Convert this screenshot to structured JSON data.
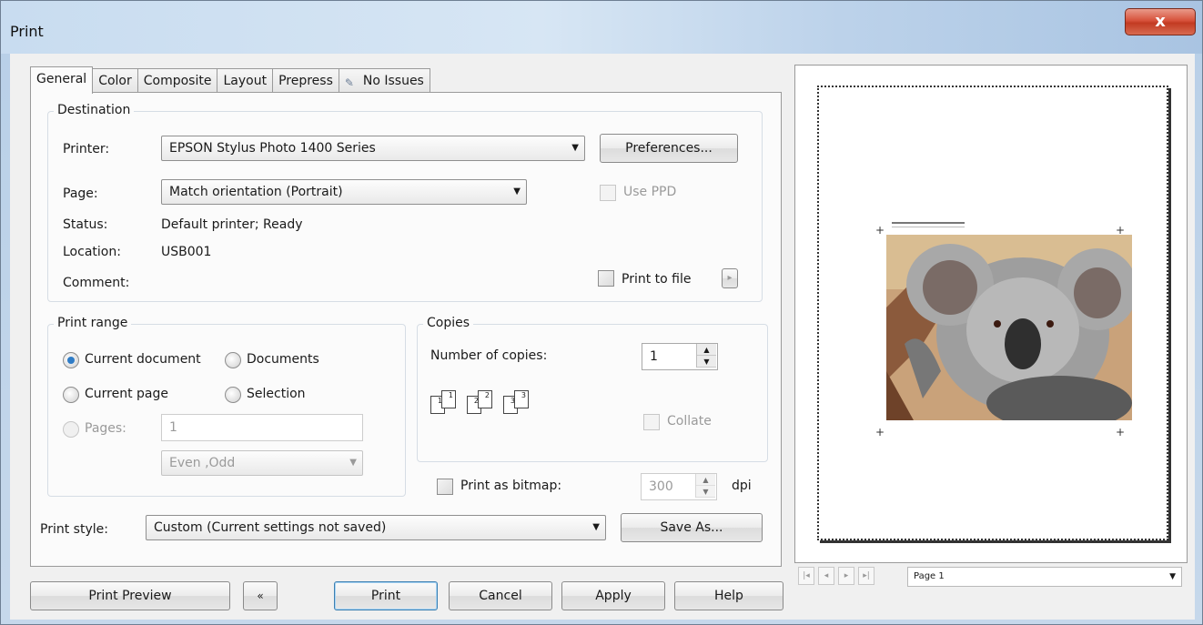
{
  "window": {
    "title": "Print",
    "close_glyph": "x"
  },
  "tabs": [
    {
      "label": "General"
    },
    {
      "label": "Color"
    },
    {
      "label": "Composite"
    },
    {
      "label": "Layout"
    },
    {
      "label": "Prepress"
    },
    {
      "label": "No Issues",
      "icon": "no-issues-icon"
    }
  ],
  "destination": {
    "title": "Destination",
    "printer_label": "Printer:",
    "printer_value": "EPSON Stylus Photo 1400 Series",
    "preferences_label": "Preferences...",
    "page_label": "Page:",
    "page_value": "Match orientation (Portrait)",
    "use_ppd_label": "Use PPD",
    "status_label": "Status:",
    "status_value": "Default printer; Ready",
    "location_label": "Location:",
    "location_value": "USB001",
    "comment_label": "Comment:",
    "print_to_file_label": "Print to file",
    "print_to_file_menu": "▸"
  },
  "print_range": {
    "title": "Print range",
    "current_document": "Current document",
    "documents": "Documents",
    "current_page": "Current page",
    "selection": "Selection",
    "pages_label": "Pages:",
    "pages_value": "1",
    "even_odd": "Even ,Odd"
  },
  "copies": {
    "title": "Copies",
    "number_label": "Number of copies:",
    "number_value": "1",
    "collate_label": "Collate",
    "collate_icon_pages": [
      "1",
      "1",
      "2",
      "2",
      "3",
      "3"
    ]
  },
  "bitmap": {
    "label": "Print as bitmap:",
    "dpi_value": "300",
    "dpi_unit": "dpi"
  },
  "print_style": {
    "label": "Print style:",
    "value": "Custom (Current settings not saved)",
    "save_as": "Save As..."
  },
  "buttons": {
    "print_preview": "Print Preview",
    "collapse": "«",
    "print": "Print",
    "cancel": "Cancel",
    "apply": "Apply",
    "help": "Help"
  },
  "preview": {
    "page_combo": "Page 1",
    "nav_first": "|◂",
    "nav_prev": "◂",
    "nav_next": "▸",
    "nav_last": "▸|"
  },
  "colors": {
    "accent": "#2f7cc6",
    "close_red": "#c23b22"
  }
}
